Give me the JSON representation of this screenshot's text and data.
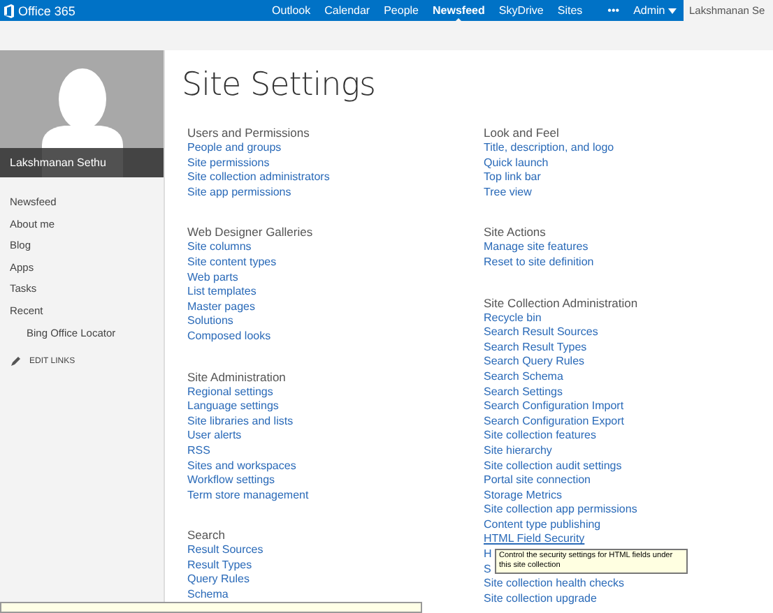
{
  "top_bar": {
    "logo": "Office 365",
    "nav": [
      {
        "label": "Outlook",
        "selected": false
      },
      {
        "label": "Calendar",
        "selected": false
      },
      {
        "label": "People",
        "selected": false
      },
      {
        "label": "Newsfeed",
        "selected": true
      },
      {
        "label": "SkyDrive",
        "selected": false
      },
      {
        "label": "Sites",
        "selected": false
      }
    ],
    "more": "•••",
    "admin": "Admin",
    "user": "Lakshmanan Se"
  },
  "sidebar": {
    "profile_name": "Lakshmanan Sethu",
    "items": [
      {
        "label": "Newsfeed"
      },
      {
        "label": "About me"
      },
      {
        "label": "Blog"
      },
      {
        "label": "Apps"
      },
      {
        "label": "Tasks"
      },
      {
        "label": "Recent",
        "children": [
          {
            "label": "Bing Office Locator"
          }
        ]
      }
    ],
    "edit_links": "EDIT LINKS"
  },
  "title": "Site Settings",
  "columns": [
    [
      {
        "heading": "Users and Permissions",
        "links": [
          "People and groups",
          "Site permissions",
          "Site collection administrators",
          "Site app permissions"
        ]
      },
      {
        "heading": "Web Designer Galleries",
        "links": [
          "Site columns",
          "Site content types",
          "Web parts",
          "List templates",
          "Master pages",
          "Solutions",
          "Composed looks"
        ]
      },
      {
        "heading": "Site Administration",
        "links": [
          "Regional settings",
          "Language settings",
          "Site libraries and lists",
          "User alerts",
          "RSS",
          "Sites and workspaces",
          "Workflow settings",
          "Term store management"
        ]
      },
      {
        "heading": "Search",
        "links": [
          "Result Sources",
          "Result Types",
          "Query Rules",
          "Schema"
        ]
      }
    ],
    [
      {
        "heading": "Look and Feel",
        "links": [
          "Title, description, and logo",
          "Quick launch",
          "Top link bar",
          "Tree view"
        ]
      },
      {
        "heading": "Site Actions",
        "links": [
          "Manage site features",
          "Reset to site definition"
        ]
      },
      {
        "heading": "Site Collection Administration",
        "links": [
          "Recycle bin",
          "Search Result Sources",
          "Search Result Types",
          "Search Query Rules",
          "Search Schema",
          "Search Settings",
          "Search Configuration Import",
          "Search Configuration Export",
          "Site collection features",
          "Site hierarchy",
          "Site collection audit settings",
          "Portal site connection",
          "Storage Metrics",
          "Site collection app permissions",
          "Content type publishing",
          {
            "label": "HTML Field Security",
            "tooltip": "Control the security settings for HTML fields under this site collection"
          },
          "H",
          "S",
          "Site collection health checks",
          "Site collection upgrade"
        ]
      }
    ]
  ]
}
